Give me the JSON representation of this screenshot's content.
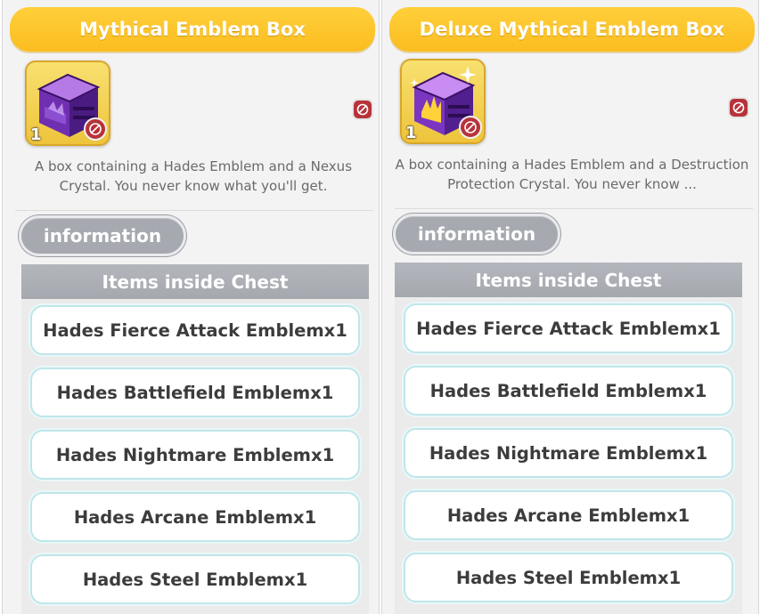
{
  "panels": [
    {
      "title": "Mythical Emblem Box",
      "quantity": "1",
      "description": "A box containing a Hades Emblem and a Nexus Crystal. You never know what you'll get.",
      "info_button": "information",
      "chest_header": "Items inside Chest",
      "items": [
        "Hades Fierce Attack Emblemx1",
        "Hades Battlefield Emblemx1",
        "Hades Nightmare Emblemx1",
        "Hades Arcane Emblemx1",
        "Hades Steel Emblemx1"
      ]
    },
    {
      "title": "Deluxe Mythical Emblem Box",
      "quantity": "1",
      "description": "A box containing a Hades Emblem and a Destruction Protection Crystal. You never know ...",
      "info_button": "information",
      "chest_header": "Items inside Chest",
      "items": [
        "Hades Fierce Attack Emblemx1",
        "Hades Battlefield Emblemx1",
        "Hades Nightmare Emblemx1",
        "Hades Arcane Emblemx1",
        "Hades Steel Emblemx1"
      ]
    }
  ],
  "colors": {
    "title_bar": "#fbbd20",
    "info_button": "#a6a9af",
    "chest_header": "#a5a8ae",
    "row_border": "#bfe6ea",
    "badge": "#b8323a"
  },
  "icons": {
    "box": "purple-chest-icon",
    "untradeable": "no-trade-icon"
  }
}
